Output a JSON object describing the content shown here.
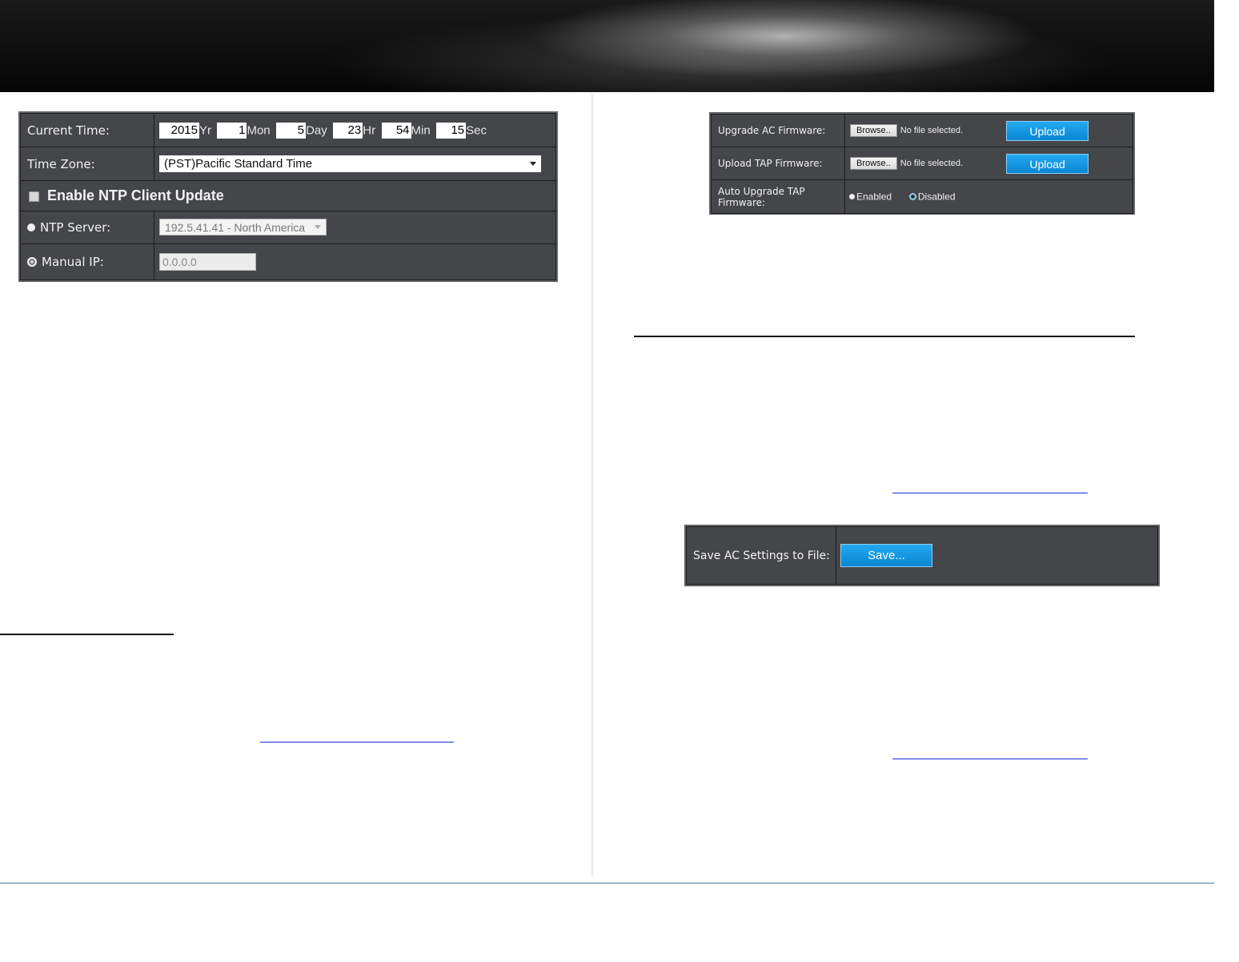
{
  "time_panel": {
    "current_time_label": "Current Time:",
    "year": "2015",
    "year_unit": "Yr",
    "month": "1",
    "month_unit": "Mon",
    "day": "5",
    "day_unit": "Day",
    "hour": "23",
    "hour_unit": "Hr",
    "minute": "54",
    "minute_unit": "Min",
    "second": "15",
    "second_unit": "Sec",
    "time_zone_label": "Time Zone:",
    "time_zone_value": "(PST)Pacific Standard Time",
    "ntp_enable_label": "Enable NTP Client Update",
    "ntp_server_label": "NTP Server:",
    "ntp_server_value": "192.5.41.41 - North America",
    "manual_ip_label": "Manual IP:",
    "manual_ip_value": "0.0.0.0"
  },
  "firmware_panel": {
    "upgrade_ac_label": "Upgrade AC Firmware:",
    "upload_tap_label": "Upload TAP Firmware:",
    "browse_label": "Browse..",
    "no_file_text": "No file selected.",
    "upload_label": "Upload",
    "auto_upgrade_label_line1": "Auto Upgrade TAP",
    "auto_upgrade_label_line2": "Firmware:",
    "enabled_label": "Enabled",
    "disabled_label": "Disabled"
  },
  "save_panel": {
    "label": "Save AC Settings to File:",
    "button_label": "Save..."
  },
  "colors": {
    "panel_bg": "#45464a",
    "button_blue": "#0a86d2",
    "link_blue": "#1a2bd6",
    "footer_line": "#4a77a8"
  }
}
